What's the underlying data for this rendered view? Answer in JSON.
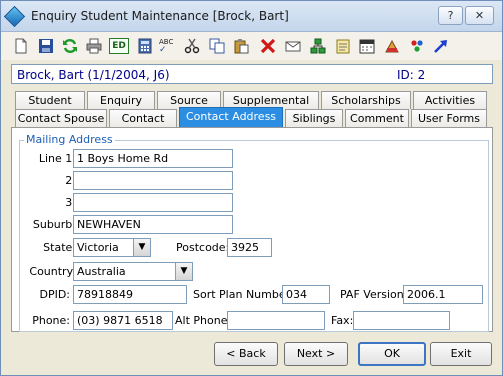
{
  "window": {
    "title": "Enquiry Student Maintenance  [Brock, Bart]"
  },
  "titlebar": {
    "help_glyph": "?",
    "close_glyph": "✕"
  },
  "toolbar": {
    "icons": [
      "new-document-icon",
      "save-icon",
      "refresh-icon",
      "print-icon",
      "edit-icon",
      "calculator-icon",
      "spell-check-icon",
      "cut-icon",
      "copy-icon",
      "paste-icon",
      "delete-icon",
      "email-icon",
      "network-icon",
      "notes-icon",
      "calendar-icon",
      "report-icon",
      "group-icon",
      "go-icon"
    ],
    "edit_label": "ED",
    "spell_label": "ABC"
  },
  "record": {
    "name": "Brock, Bart (1/1/2004, J6)",
    "id": "ID: 2"
  },
  "tabs_row1": [
    "Student",
    "Enquiry",
    "Source",
    "Supplemental",
    "Scholarships",
    "Activities"
  ],
  "tabs_row2": [
    "Contact Spouse",
    "Contact",
    "Contact Address",
    "Siblings",
    "Comment",
    "User Forms"
  ],
  "active_tab": "Contact Address",
  "mailing": {
    "legend": "Mailing Address",
    "line1_label": "Line 1:",
    "line1": "1 Boys Home Rd",
    "line2_label": "2:",
    "line2": "",
    "line3_label": "3:",
    "line3": "",
    "suburb_label": "Suburb:",
    "suburb": "NEWHAVEN",
    "state_label": "State:",
    "state": "Victoria",
    "postcode_label": "Postcode:",
    "postcode": "3925",
    "country_label": "Country:",
    "country": "Australia",
    "dpid_label": "DPID:",
    "dpid": "78918849",
    "sortplan_label": "Sort Plan Number:",
    "sortplan": "034",
    "paf_label": "PAF Version:",
    "paf": "2006.1",
    "phone_label": "Phone:",
    "phone": "(03) 9871 6518",
    "altphone_label": "Alt Phone:",
    "altphone": "",
    "fax_label": "Fax:",
    "fax": ""
  },
  "buttons": {
    "back": "< Back",
    "next": "Next >",
    "ok": "OK",
    "exit": "Exit"
  }
}
